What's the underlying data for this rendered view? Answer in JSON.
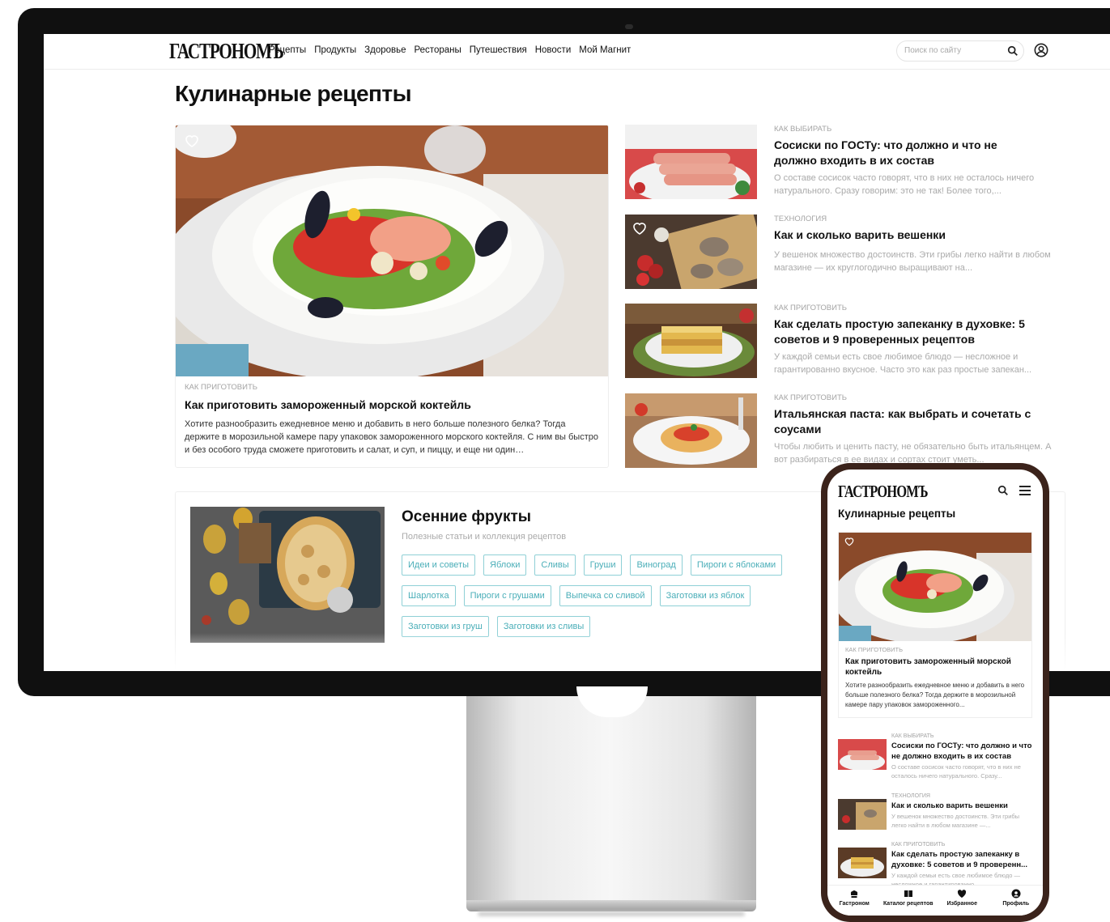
{
  "site": {
    "logo": "ГАСТРОНОМЪ",
    "nav": [
      "Рецепты",
      "Продукты",
      "Здоровье",
      "Рестораны",
      "Путешествия",
      "Новости",
      "Мой Магнит"
    ],
    "search_placeholder": "Поиск по сайту"
  },
  "page_title": "Кулинарные рецепты",
  "featured": {
    "category": "Как приготовить",
    "title": "Как приготовить замороженный морской коктейль",
    "text": "Хотите разнообразить ежедневное меню и добавить в него больше полезного белка? Тогда держите в морозильной камере пару упаковок замороженного морского коктейля. С ним вы быстро и без особого труда сможете приготовить и салат, и суп, и пиццу, и еще ни один…"
  },
  "articles": [
    {
      "category": "Как выбирать",
      "title": "Сосиски по ГОСТу: что должно и что не должно входить в их состав",
      "text": "О составе сосисок часто говорят, что в них не осталось ничего натурального. Сразу говорим: это не так! Более того,..."
    },
    {
      "category": "Технология",
      "title": "Как и сколько варить вешенки",
      "text": "У вешенок множество достоинств. Эти грибы легко найти в любом магазине — их круглогодично выращивают на..."
    },
    {
      "category": "Как приготовить",
      "title": "Как сделать простую запеканку в духовке: 5 советов и 9 проверенных рецептов",
      "text": "У каждой семьи есть свое любимое блюдо — несложное и гарантированно вкусное. Часто это как раз простые запекан..."
    },
    {
      "category": "Как приготовить",
      "title": "Итальянская паста: как выбрать и сочетать с соусами",
      "text": "Чтобы любить и ценить пасту, не обязательно быть итальянцем. А вот разбираться в ее видах и сортах стоит уметь..."
    }
  ],
  "collection": {
    "title": "Осенние фрукты",
    "subtitle": "Полезные статьи и коллекция рецептов",
    "tags": [
      "Идеи и советы",
      "Яблоки",
      "Сливы",
      "Груши",
      "Виноград",
      "Пироги с яблоками",
      "Шарлотка",
      "Пироги с грушами",
      "Выпечка со сливой",
      "Заготовки из яблок",
      "Заготовки из груш",
      "Заготовки из сливы"
    ]
  },
  "mobile": {
    "logo": "ГАСТРОНОМЪ",
    "page_title": "Кулинарные рецепты",
    "featured": {
      "category": "Как приготовить",
      "title": "Как приготовить замороженный морской коктейль",
      "text": "Хотите разнообразить ежедневное меню и добавить в него больше полезного белка? Тогда держите в морозильной камере пару упаковок замороженного..."
    },
    "items": [
      {
        "category": "Как выбирать",
        "title": "Сосиски по ГОСТу: что должно и что не должно входить в их состав",
        "text": "О составе сосисок часто говорят, что в них не осталось ничего натурального. Сразу..."
      },
      {
        "category": "Технология",
        "title": "Как и сколько варить вешенки",
        "text": "У вешенок множество достоинств. Эти грибы легко найти в любом магазине —..."
      },
      {
        "category": "Как приготовить",
        "title": "Как сделать простую запеканку в духовке: 5 советов и 9 проверенн...",
        "text": "У каждой семьи есть свое любимое блюдо — несложное и гарантированно..."
      }
    ],
    "tabbar": [
      "Гастроном",
      "Каталог рецептов",
      "Избранное",
      "Профиль"
    ]
  },
  "colors": {
    "tag_border": "#8fd0d6",
    "tag_text": "#4aaeb8",
    "phone_frame": "#3b231b"
  }
}
